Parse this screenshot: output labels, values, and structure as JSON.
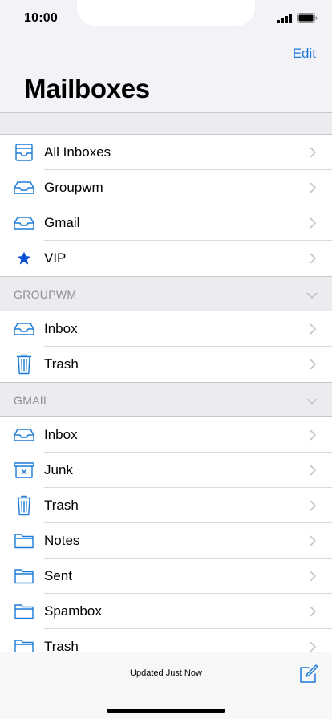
{
  "status_bar": {
    "time": "10:00"
  },
  "nav": {
    "edit_label": "Edit",
    "title": "Mailboxes"
  },
  "colors": {
    "accent": "#1a7ad9",
    "vip_star": "#0a4fd6"
  },
  "sections": [
    {
      "header": "",
      "rows": [
        {
          "label": "All Inboxes",
          "icon": "all-inboxes-icon"
        },
        {
          "label": "Groupwm",
          "icon": "inbox-icon"
        },
        {
          "label": "Gmail",
          "icon": "inbox-icon"
        },
        {
          "label": "VIP",
          "icon": "star-icon"
        }
      ]
    },
    {
      "header": "GROUPWM",
      "rows": [
        {
          "label": "Inbox",
          "icon": "inbox-icon"
        },
        {
          "label": "Trash",
          "icon": "trash-icon"
        }
      ]
    },
    {
      "header": "GMAIL",
      "rows": [
        {
          "label": "Inbox",
          "icon": "inbox-icon"
        },
        {
          "label": "Junk",
          "icon": "junk-icon"
        },
        {
          "label": "Trash",
          "icon": "trash-icon"
        },
        {
          "label": "Notes",
          "icon": "folder-icon"
        },
        {
          "label": "Sent",
          "icon": "folder-icon"
        },
        {
          "label": "Spambox",
          "icon": "folder-icon"
        },
        {
          "label": "Trash",
          "icon": "folder-icon"
        }
      ]
    }
  ],
  "toolbar": {
    "status": "Updated Just Now",
    "compose_icon": "compose-icon"
  }
}
